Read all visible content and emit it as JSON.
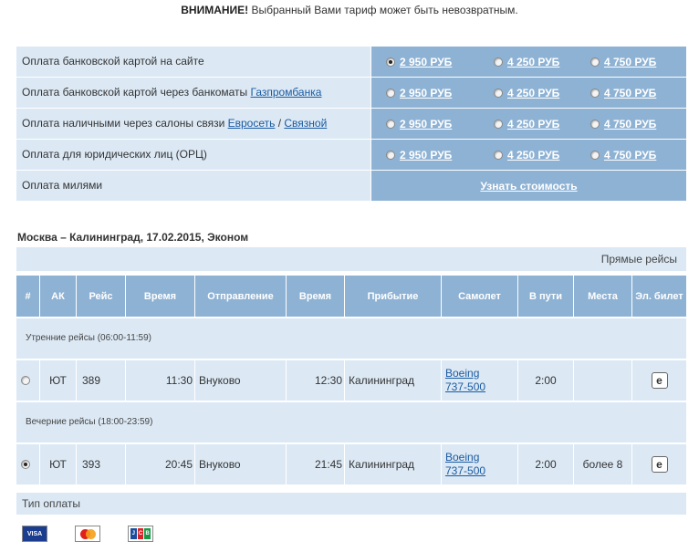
{
  "warning": {
    "bold": "ВНИМАНИЕ!",
    "text": " Выбранный Вами тариф может быть невозвратным."
  },
  "payment": {
    "rows": [
      {
        "label": "Оплата банковской картой на сайте",
        "link": "",
        "sep": "",
        "link2": "",
        "prices": [
          "2 950 РУБ",
          "4 250 РУБ",
          "4 750 РУБ"
        ],
        "selected": 0
      },
      {
        "label": "Оплата банковской картой через банкоматы ",
        "link": "Газпромбанка",
        "sep": "",
        "link2": "",
        "prices": [
          "2 950 РУБ",
          "4 250 РУБ",
          "4 750 РУБ"
        ],
        "selected": -1
      },
      {
        "label": "Оплата наличными через салоны связи ",
        "link": "Евросеть",
        "sep": " / ",
        "link2": "Связной",
        "prices": [
          "2 950 РУБ",
          "4 250 РУБ",
          "4 750 РУБ"
        ],
        "selected": -1
      },
      {
        "label": "Оплата для юридических лиц (ОРЦ)",
        "link": "",
        "sep": "",
        "link2": "",
        "prices": [
          "2 950 РУБ",
          "4 250 РУБ",
          "4 750 РУБ"
        ],
        "selected": -1
      }
    ],
    "miles": {
      "label": "Оплата милями",
      "link": "Узнать стоимость"
    }
  },
  "route_title": "Москва – Калининград, 17.02.2015, Эконом",
  "direct_label": "Прямые рейсы",
  "columns": [
    "#",
    "АК",
    "Рейс",
    "Время",
    "Отправление",
    "Время",
    "Прибытие",
    "Самолет",
    "В пути",
    "Места",
    "Эл. билет"
  ],
  "sections": {
    "morning": "Утренние рейсы (06:00-11:59)",
    "evening": "Вечерние рейсы (18:00-23:59)"
  },
  "flights": [
    {
      "airline": "ЮТ",
      "flight": "389",
      "dep_time": "11:30",
      "dep": "Внуково",
      "arr_time": "12:30",
      "arr": "Калининград",
      "plane1": "Boeing",
      "plane2": "737-500",
      "duration": "2:00",
      "seats": "",
      "eticket": "e",
      "selected": false
    },
    {
      "airline": "ЮТ",
      "flight": "393",
      "dep_time": "20:45",
      "dep": "Внуково",
      "arr_time": "21:45",
      "arr": "Калининград",
      "plane1": "Boeing",
      "plane2": "737-500",
      "duration": "2:00",
      "seats": "более 8",
      "eticket": "e",
      "selected": true
    }
  ],
  "paytype_label": "Тип оплаты",
  "cards": [
    "VISA",
    "MasterCard",
    "JCB"
  ]
}
